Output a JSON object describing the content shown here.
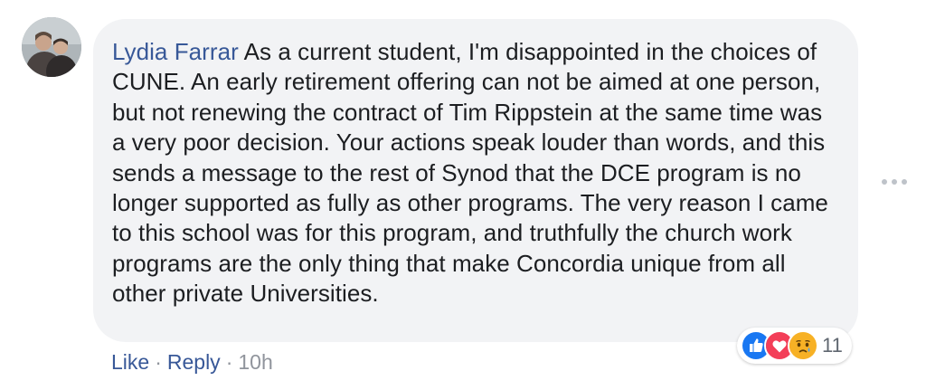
{
  "comment": {
    "author": "Lydia Farrar",
    "text": "As a current student, I'm disappointed in the choices of CUNE. An early retirement offering can not be aimed at one person, but not renewing the contract of Tim Rippstein at the same time was a very poor decision. Your actions speak louder than words, and this sends a message to the rest of Synod that the DCE program is no longer supported as fully as other programs. The very reason I came to this school was for this program, and truthfully the church work programs are the only thing that make Concordia unique from all other private Universities."
  },
  "actions": {
    "like": "Like",
    "separator": "·",
    "reply": "Reply",
    "time": "10h"
  },
  "reactions": {
    "types": [
      "like-icon",
      "love-icon",
      "sad-icon"
    ],
    "count": "11",
    "colors": {
      "like": "#1877f2",
      "love": "#f33e58",
      "sad": "#f7b125"
    }
  },
  "colors": {
    "name_link": "#385898",
    "bubble_bg": "#f2f3f5",
    "text": "#1c1e21",
    "meta": "#90949c"
  },
  "icons": {
    "avatar": "avatar",
    "more": "more-options-icon"
  }
}
